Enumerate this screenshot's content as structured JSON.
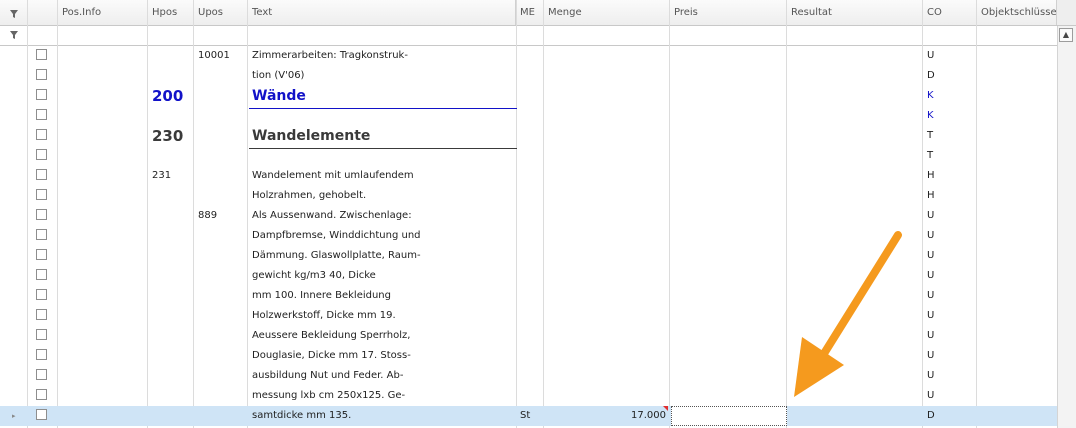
{
  "colors": {
    "blue_heading": "#1212c8",
    "dark_heading": "#3a3a3a",
    "selected_row": "#cfe4f6",
    "arrow": "#f59a1e"
  },
  "icons": {
    "header_filter": "filter-icon",
    "filterrow": "filter-icon",
    "scroll_up": "arrow-up-icon",
    "row_indicator": "row-indicator-icon"
  },
  "columns": [
    {
      "key": "posinfo",
      "label": "Pos.Info"
    },
    {
      "key": "hpos",
      "label": "Hpos"
    },
    {
      "key": "upos",
      "label": "Upos"
    },
    {
      "key": "text",
      "label": "Text"
    },
    {
      "key": "me",
      "label": "ME"
    },
    {
      "key": "menge",
      "label": "Menge"
    },
    {
      "key": "preis",
      "label": "Preis"
    },
    {
      "key": "resultat",
      "label": "Resultat"
    },
    {
      "key": "co",
      "label": "CO"
    },
    {
      "key": "objekt",
      "label": "Objektschlüssel"
    }
  ],
  "rows": [
    {
      "hpos": "",
      "upos": "10001",
      "text": "Zimmerarbeiten: Tragkonstruk-",
      "me": "",
      "menge": "",
      "co": "U",
      "style": "normal"
    },
    {
      "hpos": "",
      "upos": "",
      "text": "tion (V'06)",
      "me": "",
      "menge": "",
      "co": "D",
      "style": "normal"
    },
    {
      "hpos": "200",
      "upos": "",
      "text": "Wände",
      "me": "",
      "menge": "",
      "co": "K",
      "style": "blue"
    },
    {
      "hpos": "",
      "upos": "",
      "text": "",
      "me": "",
      "menge": "",
      "co": "K",
      "style": "blue"
    },
    {
      "hpos": "230",
      "upos": "",
      "text": "Wandelemente",
      "me": "",
      "menge": "",
      "co": "T",
      "style": "dark"
    },
    {
      "hpos": "",
      "upos": "",
      "text": "",
      "me": "",
      "menge": "",
      "co": "T",
      "style": "normal"
    },
    {
      "hpos": "231",
      "upos": "",
      "text": "Wandelement mit umlaufendem",
      "me": "",
      "menge": "",
      "co": "H",
      "style": "normal"
    },
    {
      "hpos": "",
      "upos": "",
      "text": "Holzrahmen, gehobelt.",
      "me": "",
      "menge": "",
      "co": "H",
      "style": "normal"
    },
    {
      "hpos": "",
      "upos": "889",
      "text": "Als Aussenwand. Zwischenlage:",
      "me": "",
      "menge": "",
      "co": "U",
      "style": "normal"
    },
    {
      "hpos": "",
      "upos": "",
      "text": "Dampfbremse, Winddichtung und",
      "me": "",
      "menge": "",
      "co": "U",
      "style": "normal"
    },
    {
      "hpos": "",
      "upos": "",
      "text": "Dämmung. Glaswollplatte, Raum-",
      "me": "",
      "menge": "",
      "co": "U",
      "style": "normal"
    },
    {
      "hpos": "",
      "upos": "",
      "text": "gewicht kg/m3 40, Dicke",
      "me": "",
      "menge": "",
      "co": "U",
      "style": "normal"
    },
    {
      "hpos": "",
      "upos": "",
      "text": "mm 100. Innere Bekleidung",
      "me": "",
      "menge": "",
      "co": "U",
      "style": "normal"
    },
    {
      "hpos": "",
      "upos": "",
      "text": "Holzwerkstoff, Dicke mm 19.",
      "me": "",
      "menge": "",
      "co": "U",
      "style": "normal"
    },
    {
      "hpos": "",
      "upos": "",
      "text": "Aeussere Bekleidung Sperrholz,",
      "me": "",
      "menge": "",
      "co": "U",
      "style": "normal"
    },
    {
      "hpos": "",
      "upos": "",
      "text": "Douglasie, Dicke mm 17. Stoss-",
      "me": "",
      "menge": "",
      "co": "U",
      "style": "normal"
    },
    {
      "hpos": "",
      "upos": "",
      "text": "ausbildung Nut und Feder. Ab-",
      "me": "",
      "menge": "",
      "co": "U",
      "style": "normal"
    },
    {
      "hpos": "",
      "upos": "",
      "text": "messung lxb cm 250x125. Ge-",
      "me": "",
      "menge": "",
      "co": "U",
      "style": "normal"
    },
    {
      "hpos": "",
      "upos": "",
      "text": "samtdicke mm 135.",
      "me": "St",
      "menge": "17.000",
      "co": "D",
      "style": "selected"
    }
  ]
}
